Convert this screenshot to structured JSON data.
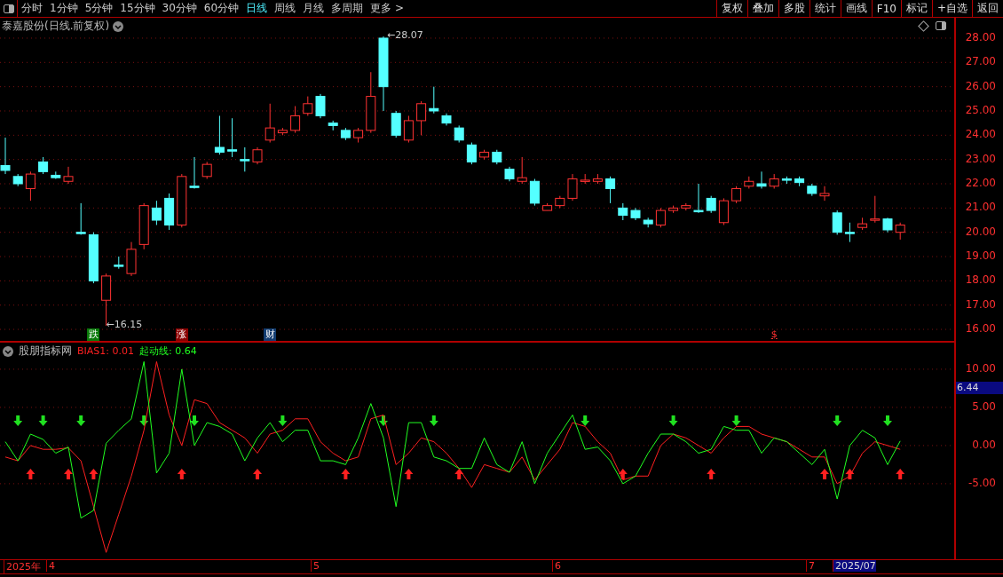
{
  "toolbar": {
    "tabs": [
      {
        "label": "分时",
        "selected": false
      },
      {
        "label": "1分钟",
        "selected": false
      },
      {
        "label": "5分钟",
        "selected": false
      },
      {
        "label": "15分钟",
        "selected": false
      },
      {
        "label": "30分钟",
        "selected": false
      },
      {
        "label": "60分钟",
        "selected": false
      },
      {
        "label": "日线",
        "selected": true
      },
      {
        "label": "周线",
        "selected": false
      },
      {
        "label": "月线",
        "selected": false
      },
      {
        "label": "多周期",
        "selected": false
      },
      {
        "label": "更多 >",
        "selected": false
      }
    ],
    "buttons": [
      "复权",
      "叠加",
      "多股",
      "统计",
      "画线",
      "F10",
      "标记",
      "+自选",
      "返回"
    ]
  },
  "chart": {
    "title": "泰嘉股份(日线.前复权)",
    "high_label": "←28.07",
    "low_label": "←16.15",
    "markers": [
      {
        "text": "跌",
        "kind": "fall"
      },
      {
        "text": "涨",
        "kind": "rise"
      },
      {
        "text": "财",
        "kind": "finance"
      },
      {
        "text": "$",
        "kind": "dividend"
      }
    ],
    "chart_data": {
      "type": "candlestick",
      "ylim": [
        15.49,
        28.84
      ],
      "grid": true,
      "yticks": [
        {
          "value": 28,
          "label": "28.00"
        },
        {
          "value": 27,
          "label": "27.00"
        },
        {
          "value": 26,
          "label": "26.00"
        },
        {
          "value": 25,
          "label": "25.00"
        },
        {
          "value": 24,
          "label": "24.00"
        },
        {
          "value": 23,
          "label": "23.00"
        },
        {
          "value": 22,
          "label": "22.00"
        },
        {
          "value": 21,
          "label": "21.00"
        },
        {
          "value": 20,
          "label": "20.00"
        },
        {
          "value": 19,
          "label": "19.00"
        },
        {
          "value": 18,
          "label": "18.00"
        },
        {
          "value": 17,
          "label": "17.00"
        },
        {
          "value": 16,
          "label": "16.00"
        }
      ],
      "ohlc": [
        [
          22.75,
          23.9,
          22.4,
          22.55
        ],
        [
          22.3,
          22.4,
          21.9,
          22.0
        ],
        [
          21.8,
          22.5,
          21.3,
          22.4
        ],
        [
          22.9,
          23.1,
          22.4,
          22.5
        ],
        [
          22.35,
          22.5,
          22.2,
          22.25
        ],
        [
          22.1,
          22.7,
          22.0,
          22.3
        ],
        [
          20.0,
          21.2,
          19.9,
          19.98
        ],
        [
          19.9,
          20.0,
          17.9,
          18.0
        ],
        [
          17.2,
          18.3,
          16.15,
          18.2
        ],
        [
          18.65,
          19.0,
          18.5,
          18.6
        ],
        [
          18.3,
          19.6,
          18.2,
          19.3
        ],
        [
          19.5,
          21.2,
          19.3,
          21.1
        ],
        [
          21.0,
          21.3,
          20.3,
          20.5
        ],
        [
          21.4,
          21.6,
          20.1,
          20.3
        ],
        [
          20.3,
          22.4,
          20.2,
          22.3
        ],
        [
          21.9,
          23.1,
          21.8,
          21.85
        ],
        [
          22.3,
          22.9,
          22.2,
          22.8
        ],
        [
          23.5,
          24.8,
          23.2,
          23.3
        ],
        [
          23.4,
          24.7,
          23.1,
          23.35
        ],
        [
          23.0,
          23.5,
          22.5,
          22.98
        ],
        [
          22.9,
          23.5,
          22.8,
          23.4
        ],
        [
          23.8,
          25.3,
          23.7,
          24.3
        ],
        [
          24.1,
          24.3,
          24.0,
          24.2
        ],
        [
          24.2,
          25.2,
          24.1,
          24.8
        ],
        [
          24.9,
          25.6,
          24.8,
          25.3
        ],
        [
          25.6,
          25.7,
          24.7,
          24.8
        ],
        [
          24.5,
          24.6,
          24.2,
          24.4
        ],
        [
          24.2,
          24.3,
          23.8,
          23.9
        ],
        [
          23.9,
          24.3,
          23.7,
          24.2
        ],
        [
          24.2,
          26.6,
          24.1,
          25.6
        ],
        [
          28.0,
          28.07,
          25.0,
          26.0
        ],
        [
          24.9,
          25.0,
          23.9,
          24.0
        ],
        [
          23.8,
          24.8,
          23.7,
          24.6
        ],
        [
          24.6,
          25.4,
          24.0,
          25.3
        ],
        [
          25.1,
          26.0,
          24.9,
          25.0
        ],
        [
          24.8,
          24.9,
          24.4,
          24.5
        ],
        [
          24.3,
          24.4,
          23.7,
          23.8
        ],
        [
          23.6,
          23.7,
          22.8,
          22.9
        ],
        [
          23.1,
          23.4,
          23.0,
          23.3
        ],
        [
          23.3,
          23.4,
          22.8,
          22.9
        ],
        [
          22.6,
          22.7,
          22.1,
          22.2
        ],
        [
          22.1,
          23.1,
          22.0,
          22.25
        ],
        [
          22.1,
          22.2,
          21.1,
          21.2
        ],
        [
          20.9,
          21.2,
          20.9,
          21.1
        ],
        [
          21.1,
          21.5,
          21.0,
          21.4
        ],
        [
          21.4,
          22.4,
          21.3,
          22.2
        ],
        [
          22.1,
          22.4,
          22.0,
          22.15
        ],
        [
          22.1,
          22.4,
          22.0,
          22.2
        ],
        [
          22.2,
          22.3,
          21.2,
          21.8
        ],
        [
          21.0,
          21.2,
          20.5,
          20.7
        ],
        [
          20.9,
          21.0,
          20.5,
          20.6
        ],
        [
          20.5,
          20.6,
          20.2,
          20.35
        ],
        [
          20.3,
          21.0,
          20.2,
          20.9
        ],
        [
          20.9,
          21.1,
          20.8,
          21.0
        ],
        [
          21.0,
          21.2,
          20.9,
          21.1
        ],
        [
          20.9,
          22.0,
          20.8,
          20.85
        ],
        [
          21.4,
          21.5,
          20.8,
          20.9
        ],
        [
          20.4,
          21.4,
          20.3,
          21.3
        ],
        [
          21.3,
          21.9,
          21.2,
          21.8
        ],
        [
          21.9,
          22.3,
          21.8,
          22.1
        ],
        [
          22.0,
          22.5,
          21.8,
          21.9
        ],
        [
          21.9,
          22.4,
          21.8,
          22.2
        ],
        [
          22.2,
          22.3,
          22.0,
          22.15
        ],
        [
          22.2,
          22.3,
          21.9,
          22.05
        ],
        [
          21.9,
          22.0,
          21.5,
          21.6
        ],
        [
          21.5,
          21.9,
          21.3,
          21.6
        ],
        [
          20.8,
          20.9,
          19.9,
          20.0
        ],
        [
          20.0,
          20.4,
          19.6,
          19.98
        ],
        [
          20.2,
          20.6,
          20.1,
          20.35
        ],
        [
          20.5,
          21.5,
          20.4,
          20.55
        ],
        [
          20.55,
          20.6,
          20.0,
          20.1
        ],
        [
          20.0,
          20.4,
          19.7,
          20.3
        ]
      ]
    }
  },
  "indicator": {
    "name": "股朋指标网",
    "separator": ":",
    "legend": [
      {
        "value": "0.01"
      },
      {
        "value": "0.64"
      }
    ],
    "chart_data": {
      "type": "line",
      "ylim": [
        -14.9,
        13.6
      ],
      "grid": true,
      "yticks": [
        {
          "value": 10,
          "label": "10.00"
        },
        {
          "value": 5,
          "label": "5.00"
        },
        {
          "value": 0,
          "label": "0.00"
        },
        {
          "value": -5,
          "label": "-5.00"
        }
      ],
      "series": [
        {
          "name": "BIAS1",
          "color": "#ff2020",
          "values": [
            -1.5,
            -2,
            0,
            -0.5,
            -0.5,
            -0.3,
            -2,
            -8,
            -14,
            -9,
            -4,
            2,
            11,
            4,
            0,
            6,
            5.5,
            3,
            2,
            1,
            -1,
            1.5,
            2,
            3.5,
            3.5,
            0.5,
            -1,
            -2,
            -1.5,
            3.5,
            4,
            -2.5,
            -1,
            1,
            0.5,
            -1,
            -3,
            -5.5,
            -2.5,
            -3,
            -3.5,
            -1.5,
            -4.5,
            -2.5,
            -0.5,
            3,
            2.5,
            0.5,
            -1,
            -4.5,
            -4,
            -4,
            0,
            1.5,
            1,
            0,
            -1,
            1,
            2.5,
            2.5,
            1.5,
            1,
            0.5,
            -0.5,
            -1.5,
            -1.5,
            -5,
            -4,
            -1,
            0.5,
            0,
            -0.5
          ]
        },
        {
          "name": "起动线",
          "color": "#20ff20",
          "values": [
            0.5,
            -2,
            1.5,
            0.8,
            -1,
            -0.2,
            -9.5,
            -8.5,
            0.3,
            2,
            3.5,
            11,
            -3.6,
            -1,
            10,
            0,
            3,
            2.5,
            1.5,
            -2,
            1,
            3,
            0.5,
            2,
            2,
            -2,
            -2,
            -2.5,
            1,
            5.5,
            1,
            -8,
            3,
            3,
            -1.5,
            -2,
            -3,
            -3,
            1,
            -2.5,
            -3.5,
            0.5,
            -5,
            -1,
            1.5,
            4,
            -0.5,
            -0.2,
            -2,
            -5,
            -4,
            -1,
            1.5,
            1.5,
            0.5,
            -1,
            -0.5,
            2.5,
            2,
            2,
            -1,
            1,
            0.5,
            -1,
            -2.5,
            -0.5,
            -7,
            0,
            2,
            1,
            -2.5,
            0.6
          ]
        }
      ]
    },
    "current_value": "6.44"
  },
  "time_axis": {
    "labels": [
      {
        "text": "2025年",
        "selected": false
      },
      {
        "text": "4",
        "selected": false
      },
      {
        "text": "5",
        "selected": false
      },
      {
        "text": "6",
        "selected": false
      },
      {
        "text": "7",
        "selected": false
      },
      {
        "text": "2025/07",
        "selected": true
      }
    ]
  }
}
